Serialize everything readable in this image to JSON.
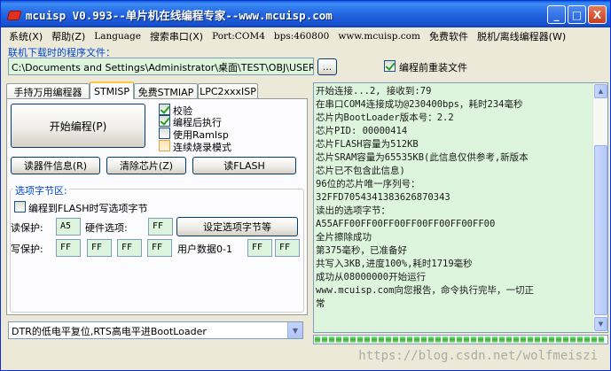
{
  "window": {
    "title": "mcuisp V0.993--单片机在线编程专家--www.mcuisp.com",
    "buttons": {
      "minimize": "_",
      "maximize": "□",
      "close": "X"
    }
  },
  "menu": [
    {
      "label": "系统(X)",
      "serif": false
    },
    {
      "label": "帮助(Z)",
      "serif": false
    },
    {
      "label": "Language",
      "serif": true
    },
    {
      "label": "搜索串口(X)",
      "serif": false
    },
    {
      "label": "Port:COM4",
      "serif": true
    },
    {
      "label": "bps:460800",
      "serif": true
    },
    {
      "label": "www.mcuisp.com",
      "serif": true
    },
    {
      "label": "免费软件",
      "serif": false
    },
    {
      "label": "脱机/离线编程器(W)",
      "serif": false
    }
  ],
  "file_section": {
    "label": "联机下载时的程序文件：",
    "path": "C:\\Documents and Settings\\Administrator\\桌面\\TEST\\OBJ\\USER.hex",
    "browse_label": "...",
    "reload_label": "编程前重装文件",
    "reload_checked": true
  },
  "tabs": [
    "手持万用编程器",
    "STMISP",
    "免费STMIAP",
    "LPC2xxxISP"
  ],
  "active_tab": 1,
  "actions": {
    "start": "开始编程(P)",
    "read_info": "读器件信息(R)",
    "erase": "清除芯片(Z)",
    "read_flash": "读FLASH"
  },
  "options": [
    {
      "label": "校验",
      "checked": true,
      "style": "normal"
    },
    {
      "label": "编程后执行",
      "checked": true,
      "style": "normal"
    },
    {
      "label": "使用RamIsp",
      "checked": false,
      "style": "normal"
    },
    {
      "label": "连续烧录模式",
      "checked": false,
      "style": "orange"
    }
  ],
  "option_bytes": {
    "group_label": "选项字节区:",
    "write_to_flash": "编程到FLASH时写选项字节",
    "read_protect_label": "读保护:",
    "read_protect_value": "A5",
    "hw_option_label": "硬件选项:",
    "hw_option_value": "FF",
    "set_button": "设定选项字节等",
    "write_protect_label": "写保护:",
    "write_protect_values": [
      "FF",
      "FF",
      "FF",
      "FF"
    ],
    "user_data_label": "用户数据0-1",
    "user_data_values": [
      "FF",
      "FF"
    ]
  },
  "boot_mode": "DTR的低电平复位,RTS高电平进BootLoader",
  "log": [
    "开始连接...2, 接收到:79",
    "在串口COM4连接成功@230400bps，耗时234毫秒",
    "芯片内BootLoader版本号：2.2",
    "芯片PID: 00000414",
    "芯片FLASH容量为512KB",
    "芯片SRAM容量为65535KB(此信息仅供参考,新版本",
    "芯片已不包含此信息)",
    "96位的芯片唯一序列号：",
    "32FFD7054341383626870343",
    "读出的选项字节：",
    "A55AFF00FF00FF00FF00FF00FF00FF00",
    "全片擦除成功",
    "第375毫秒，已准备好",
    "共写入3KB,进度100%,耗时1719毫秒",
    "成功从08000000开始运行",
    "www.mcuisp.com向您报告，命令执行完毕，一切正",
    "常"
  ],
  "progress": {
    "value": 1.0
  },
  "watermark": "https://blog.csdn.net/wolfmeiszi"
}
